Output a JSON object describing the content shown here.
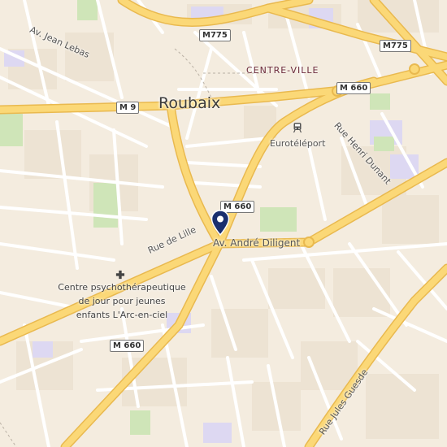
{
  "map": {
    "city": "Roubaix",
    "district": "CENTRE-VILLE",
    "streets": {
      "jean_lebas": "Av. Jean Lebas",
      "lille": "Rue de Lille",
      "dilligent": "Av. André Diligent",
      "henri_dunant": "Rue Henri Dunant",
      "jules_guesde": "Rue Jules Guesde"
    },
    "shields": {
      "m775_top": "M775",
      "m775_right": "M775",
      "m9": "M 9",
      "m660_top": "M 660",
      "m660_center": "M 660",
      "m660_bottom": "M 660"
    },
    "pois": {
      "station": "Eurotéléport",
      "clinic_line1": "Centre psychothérapeutique",
      "clinic_line2": "de jour pour jeunes",
      "clinic_line3": "enfants L'Arc-en-ciel"
    },
    "icons": {
      "pin": "map-pin-icon",
      "station": "tram-icon",
      "clinic": "medical-cross-icon"
    },
    "colors": {
      "land": "#f4ecdf",
      "block": "#ede3d3",
      "road_major": "#fbd877",
      "road_casing": "#e9b94f",
      "park": "#cfe5b8",
      "water": "#ddd8f2",
      "pin": "#1a2f6e"
    }
  }
}
